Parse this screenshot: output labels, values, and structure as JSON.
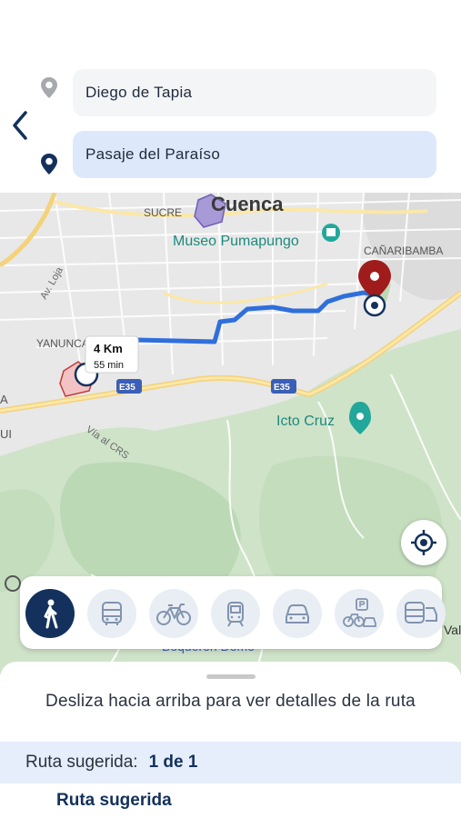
{
  "search": {
    "origin_value": "Diego de Tapia",
    "destination_value": "Pasaje del Paraíso"
  },
  "map": {
    "labels": {
      "city": "Cuenca",
      "sucre": "SUCRE",
      "museo": "Museo Pumapungo",
      "canaribamba": "CAÑARIBAMBA",
      "yanuncay": "YANUNCAY",
      "av_loja": "Av. Loja",
      "ecto_cruz": "Icto Cruz",
      "via_crs": "Vía al CRS",
      "e35": "E35",
      "boqueron": "Boquerón Domo",
      "val": "Val",
      "a": "A",
      "ui": "UI"
    },
    "route": {
      "distance": "4 Km",
      "duration": "55 min",
      "color": "#2f6fdc"
    },
    "destination_marker_color": "#a01c1c"
  },
  "transport_modes": [
    {
      "name": "walk",
      "active": true
    },
    {
      "name": "bus",
      "active": false
    },
    {
      "name": "bicycle",
      "active": false
    },
    {
      "name": "tram",
      "active": false
    },
    {
      "name": "car",
      "active": false
    },
    {
      "name": "park-and-ride",
      "active": false
    },
    {
      "name": "taxi-bus",
      "active": false
    }
  ],
  "sheet": {
    "hint": "Desliza hacia arriba para ver detalles de la ruta",
    "suggested_label": "Ruta sugerida:",
    "suggested_value": "1 de 1",
    "route_title": "Ruta sugerida"
  },
  "colors": {
    "primary": "#13315c",
    "destination_field": "#dde9fb",
    "origin_field": "#f4f5f7"
  }
}
